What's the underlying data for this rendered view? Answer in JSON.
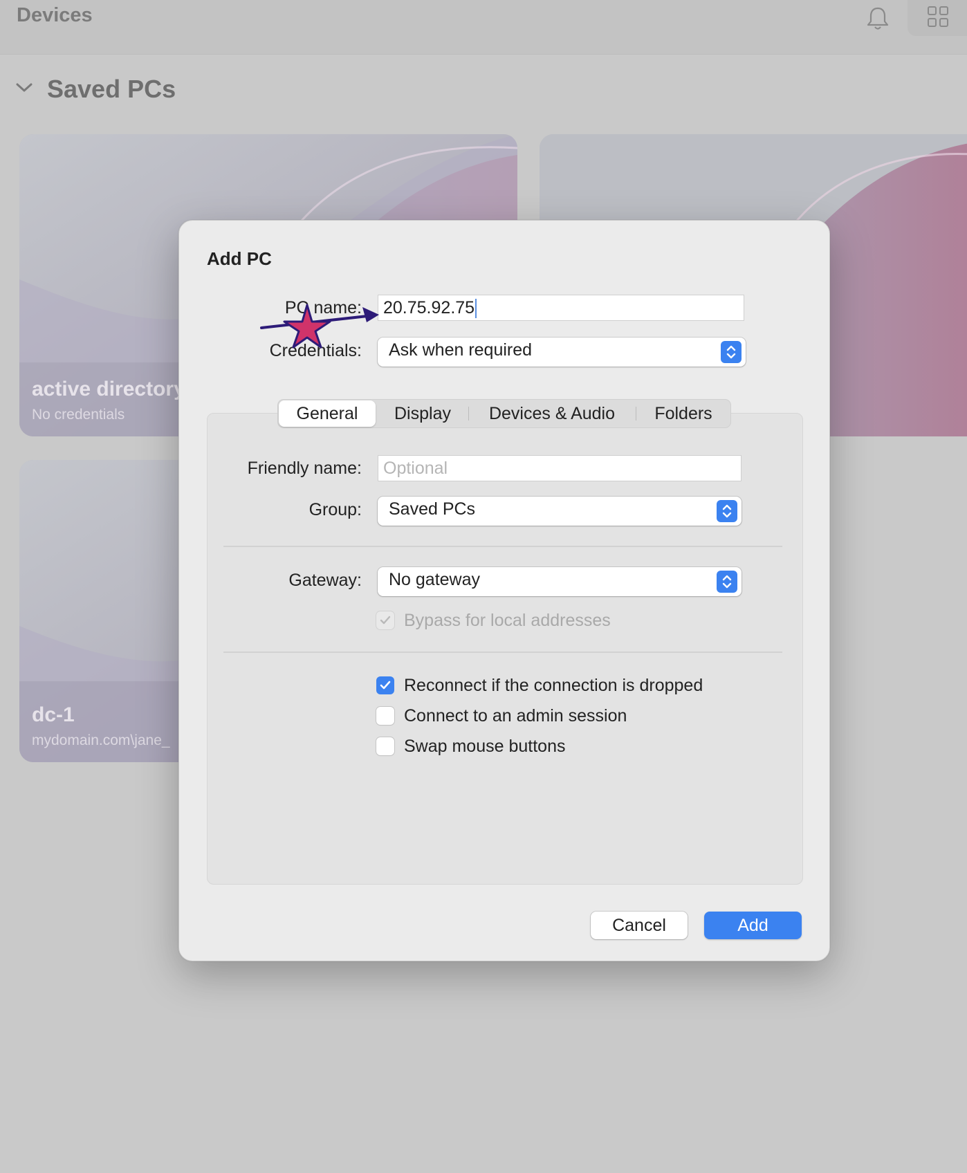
{
  "app": {
    "title": "Devices"
  },
  "section": {
    "label": "Saved PCs"
  },
  "cards": [
    {
      "name": "active directory",
      "sub": "No credentials"
    },
    {
      "name": "",
      "sub": ""
    },
    {
      "name": "dc-1",
      "sub": "mydomain.com\\jane_"
    }
  ],
  "dialog": {
    "title": "Add PC",
    "pc_name_label": "PC name:",
    "pc_name_value": "20.75.92.75",
    "credentials_label": "Credentials:",
    "credentials_value": "Ask when required",
    "tabs": [
      "General",
      "Display",
      "Devices & Audio",
      "Folders"
    ],
    "active_tab": "General",
    "friendly_name_label": "Friendly name:",
    "friendly_name_placeholder": "Optional",
    "group_label": "Group:",
    "group_value": "Saved PCs",
    "gateway_label": "Gateway:",
    "gateway_value": "No gateway",
    "bypass_label": "Bypass for local addresses",
    "bypass_checked": true,
    "reconnect_label": "Reconnect if the connection is dropped",
    "reconnect_checked": true,
    "admin_label": "Connect to an admin session",
    "admin_checked": false,
    "swap_label": "Swap mouse buttons",
    "swap_checked": false,
    "cancel_label": "Cancel",
    "add_label": "Add"
  },
  "colors": {
    "accent": "#3b82f0",
    "annotation_arrow": "#2d1b78",
    "annotation_star": "#d0336a"
  },
  "icons": [
    "bell-icon",
    "grid-view-icon",
    "chevron-down-icon",
    "popup-stepper-icon",
    "checkmark-icon",
    "star-annotation-icon",
    "arrow-annotation-icon"
  ]
}
